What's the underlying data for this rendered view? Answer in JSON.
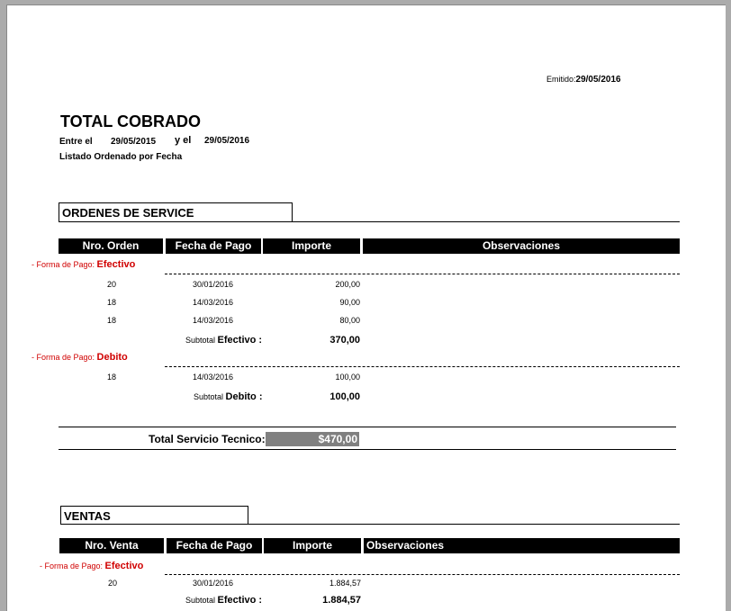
{
  "report": {
    "emitido_label": "Emitido:",
    "emitido_value": "29/05/2016",
    "title": "TOTAL COBRADO",
    "entre_label": "Entre el",
    "date_from": "29/05/2015",
    "y_el_label": "y el",
    "date_to": "29/05/2016",
    "order_note": "Listado Ordenado por Fecha"
  },
  "service": {
    "section_title": "ORDENES DE SERVICE",
    "headers": [
      "Nro. Orden",
      "Fecha de Pago",
      "Importe",
      "Observaciones"
    ],
    "groups": [
      {
        "prefix": "- Forma de Pago:",
        "name": "Efectivo",
        "rows": [
          {
            "nro": "20",
            "fecha": "30/01/2016",
            "importe": "200,00"
          },
          {
            "nro": "18",
            "fecha": "14/03/2016",
            "importe": "90,00"
          },
          {
            "nro": "18",
            "fecha": "14/03/2016",
            "importe": "80,00"
          }
        ],
        "subtotal_label": "Subtotal",
        "subtotal_name": "Efectivo :",
        "subtotal_value": "370,00"
      },
      {
        "prefix": "- Forma de Pago:",
        "name": "Debito",
        "rows": [
          {
            "nro": "18",
            "fecha": "14/03/2016",
            "importe": "100,00"
          }
        ],
        "subtotal_label": "Subtotal",
        "subtotal_name": "Debito :",
        "subtotal_value": "100,00"
      }
    ],
    "total_label": "Total Servicio Tecnico:",
    "total_value": "$470,00"
  },
  "ventas": {
    "section_title": "VENTAS",
    "headers": [
      "Nro. Venta",
      "Fecha de Pago",
      "Importe",
      "Observaciones"
    ],
    "groups": [
      {
        "prefix": "- Forma de Pago:",
        "name": "Efectivo",
        "rows": [
          {
            "nro": "20",
            "fecha": "30/01/2016",
            "importe": "1.884,57"
          }
        ],
        "subtotal_label": "Subtotal",
        "subtotal_name": "Efectivo :",
        "subtotal_value": "1.884,57"
      }
    ]
  },
  "colors": {
    "header_bg": "#000000",
    "payment_method": "#d00000",
    "total_highlight": "#808080"
  }
}
